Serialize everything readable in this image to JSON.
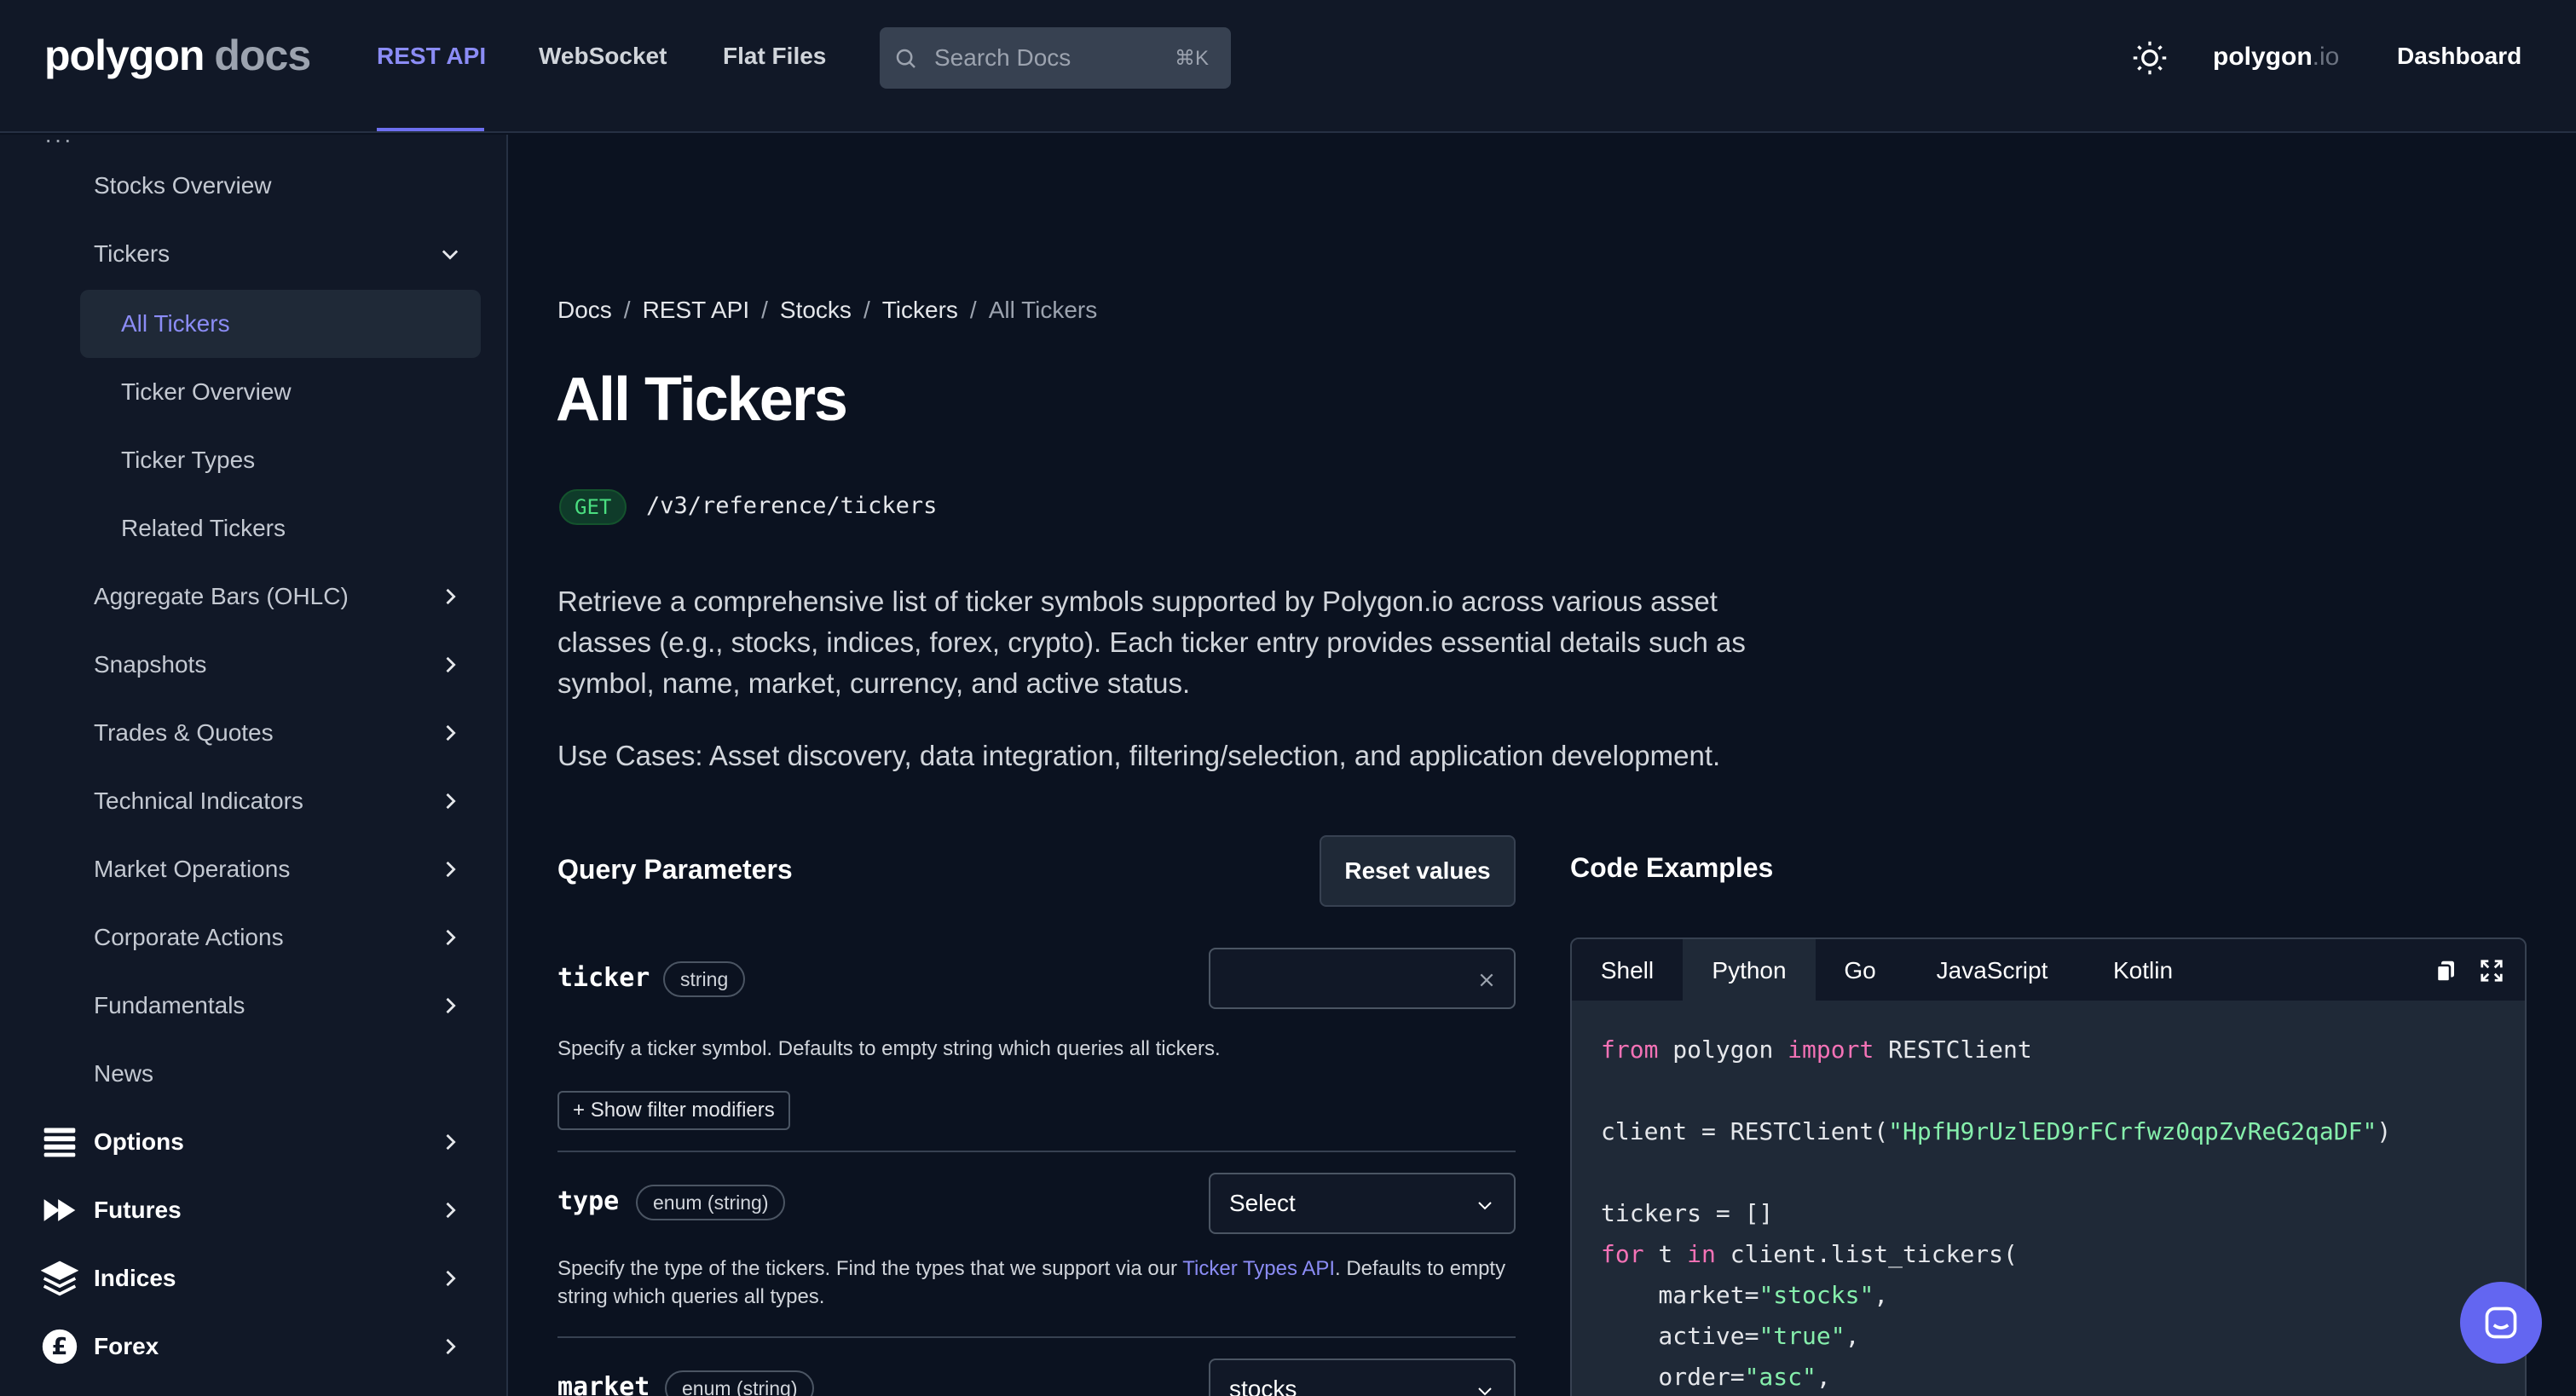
{
  "header": {
    "logo_main": "polygon",
    "logo_suffix": "docs",
    "nav": [
      "REST API",
      "WebSocket",
      "Flat Files"
    ],
    "search_placeholder": "Search Docs",
    "search_shortcut": "⌘K",
    "brand_main": "polygon",
    "brand_suffix": ".io",
    "dashboard": "Dashboard"
  },
  "sidebar": {
    "stocks_overview": "Stocks Overview",
    "tickers": "Tickers",
    "tickers_sub": [
      "All Tickers",
      "Ticker Overview",
      "Ticker Types",
      "Related Tickers"
    ],
    "sections": [
      "Aggregate Bars (OHLC)",
      "Snapshots",
      "Trades & Quotes",
      "Technical Indicators",
      "Market Operations",
      "Corporate Actions",
      "Fundamentals"
    ],
    "news": "News",
    "groups": [
      "Options",
      "Futures",
      "Indices",
      "Forex"
    ]
  },
  "breadcrumb": [
    "Docs",
    "REST API",
    "Stocks",
    "Tickers",
    "All Tickers"
  ],
  "page": {
    "title": "All Tickers",
    "method": "GET",
    "endpoint": "/v3/reference/tickers",
    "description": "Retrieve a comprehensive list of ticker symbols supported by Polygon.io across various asset classes (e.g., stocks, indices, forex, crypto). Each ticker entry provides essential details such as symbol, name, market, currency, and active status.",
    "use_cases": "Use Cases: Asset discovery, data integration, filtering/selection, and application development."
  },
  "query_params": {
    "title": "Query Parameters",
    "reset_label": "Reset values",
    "ticker": {
      "name": "ticker",
      "type": "string",
      "desc": "Specify a ticker symbol. Defaults to empty string which queries all tickers.",
      "value": "",
      "filter_label": "Show filter modifiers"
    },
    "type": {
      "name": "type",
      "type": "enum (string)",
      "desc_before": "Specify the type of the tickers. Find the types that we support via our ",
      "desc_link": "Ticker Types API",
      "desc_after": ". Defaults to empty string which queries all types.",
      "selected": "Select"
    },
    "market": {
      "name": "market",
      "type": "enum (string)",
      "selected": "stocks"
    }
  },
  "code_examples": {
    "title": "Code Examples",
    "tabs": [
      "Shell",
      "Python",
      "Go",
      "JavaScript",
      "Kotlin"
    ],
    "active_tab": "Python",
    "api_key": "HpfH9rUzlED9rFCrfwz0qpZvReG2qaDF"
  },
  "colors": {
    "accent": "#8b8cf5",
    "background": "#0b1220",
    "panel": "#111827",
    "get_badge": "#4ade80",
    "keyword": "#f472b6",
    "string": "#86efac"
  }
}
